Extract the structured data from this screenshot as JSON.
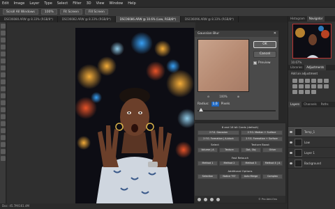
{
  "menu": [
    "Edit",
    "Image",
    "Layer",
    "Type",
    "Select",
    "Filter",
    "3D",
    "View",
    "Window",
    "Help"
  ],
  "options": {
    "scroll_all": "Scroll All Windows",
    "zoom": "100%",
    "fit_screen": "Fit Screen",
    "fill_screen": "Fill Screen"
  },
  "doc_tabs": [
    {
      "label": "DSC06080.ARW @ 8.33% (RGB/8*)",
      "active": false
    },
    {
      "label": "DSC06082.ARW @ 8.33% (RGB/8*)",
      "active": false
    },
    {
      "label": "DSC06086.ARW @ 10.6% (Low, RGB/8*)",
      "active": true
    },
    {
      "label": "DSC06096.ARW @ 8.33% (RGB/8*)",
      "active": false
    }
  ],
  "status": "Doc: 45.7M/161.4M",
  "dialog": {
    "title": "Gaussian Blur",
    "close": "✕",
    "ok": "OK",
    "cancel": "Cancel",
    "preview_label": "Preview",
    "zoom_out": "⊖",
    "zoom_value": "100%",
    "zoom_in": "⊕",
    "radius_label": "Radius:",
    "radius_value": "1.0",
    "radius_unit": "Pixels"
  },
  "plugin": {
    "header": "8 and 16 bit Cards (default)",
    "freq_buttons": [
      "2 F.G. Gaussian",
      "2 F.G. Median + Surface",
      "2 F.G. Formation | A-block",
      "2 F.G. Formation + Surface"
    ],
    "select_label": "Select",
    "texture_label": "Texture Boost",
    "select_buttons": [
      "Volume | A",
      "Texture",
      "Dot, Obj",
      "Other"
    ],
    "fast_label": "Fast Retouch",
    "methods": [
      "Method 1",
      "Method 2",
      "Method 3",
      "Method 4 | A"
    ],
    "additional_label": "Additional Options",
    "extra_buttons": [
      "Selection",
      "Notice TST",
      "Auto Merge",
      "Complex"
    ],
    "footer": "© Pro Add-Ons"
  },
  "panels": {
    "top_tabs": [
      "Histogram",
      "Navigator"
    ],
    "zoom": "10.67%",
    "mid_tabs": [
      "Libraries",
      "Adjustments"
    ],
    "add_adjustment": "Add an adjustment",
    "layer_tabs": [
      "Layers",
      "Channels",
      "Paths"
    ],
    "layers": [
      {
        "name": "Temp_1",
        "selected": true
      },
      {
        "name": "Low",
        "selected": false
      },
      {
        "name": "Layer 1",
        "selected": false
      },
      {
        "name": "Background",
        "selected": false
      }
    ]
  }
}
